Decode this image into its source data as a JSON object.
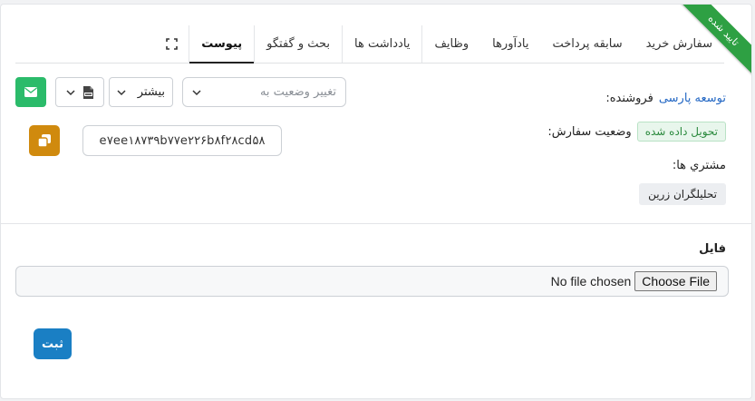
{
  "ribbon": {
    "label": "تایید شده",
    "color": "#2ea043"
  },
  "tabs": [
    {
      "label": "سفارش خرید",
      "name": "tab-purchase-order"
    },
    {
      "label": "سابقه پرداخت",
      "name": "tab-payment-history"
    },
    {
      "label": "یادآورها",
      "name": "tab-reminders"
    },
    {
      "label": "وظایف",
      "name": "tab-tasks"
    },
    {
      "label": "یادداشت ها",
      "name": "tab-notes"
    },
    {
      "label": "بحث و گفتگو",
      "name": "tab-discussion"
    },
    {
      "label": "پیوست",
      "name": "tab-attachment",
      "active": true
    }
  ],
  "expand_icon": "expand-icon",
  "info": {
    "seller_label": "فروشنده:",
    "seller_value": "توسعه پارسی",
    "status_label": "وضعیت سفارش:",
    "status_value": "تحویل داده شده",
    "customers_label": "مشتري ها:",
    "customer_value": "تحلیلگران زرین"
  },
  "toolbar": {
    "status_placeholder": "تغییر وضعیت به",
    "more_label": "بیشتر",
    "pdf_icon": "pdf-icon",
    "mail_icon": "envelope-icon",
    "mail_color": "#2bbb6a"
  },
  "order_code": "e۷ee۱۸۷۳۹b۷۷e۲۲۶b۸f۲۸cd۵۸",
  "copy_icon": "copy-icon",
  "file": {
    "label": "فایل",
    "choose_label": "Choose File",
    "no_file_text": "No file chosen"
  },
  "submit_label": "ثبت",
  "colors": {
    "accent": "#1a7fc4",
    "copy": "#d08a0e",
    "link": "#2468c4"
  }
}
